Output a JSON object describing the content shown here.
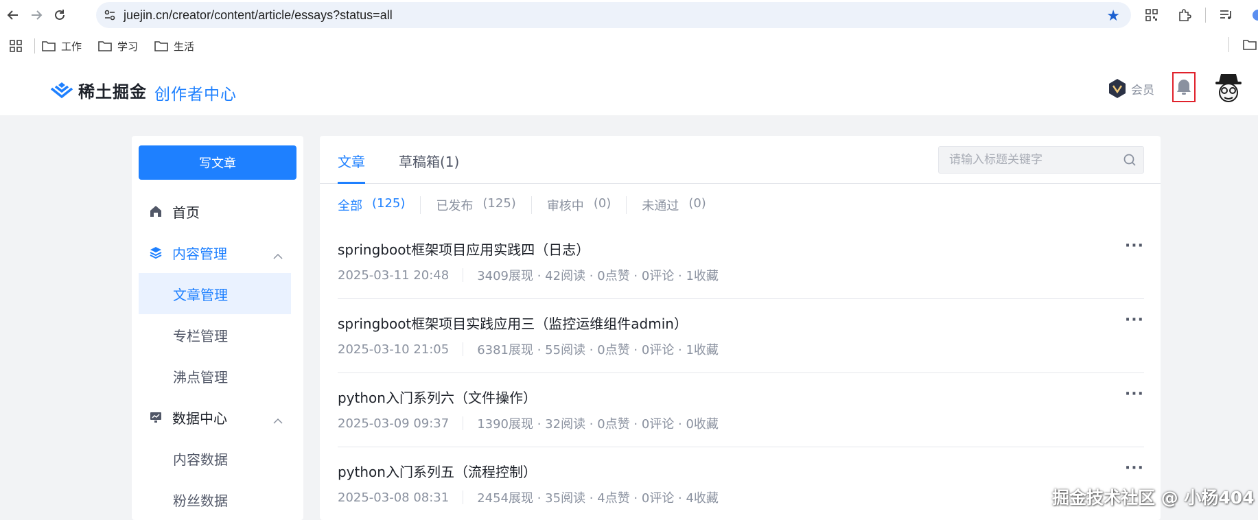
{
  "browser": {
    "url": "juejin.cn/creator/content/article/essays?status=all",
    "bookmarks": [
      "工作",
      "学习",
      "生活"
    ]
  },
  "header": {
    "logo_text": "稀土掘金",
    "creator_center": "创作者中心",
    "vip_label": "会员"
  },
  "sidebar": {
    "write_button": "写文章",
    "home": "首页",
    "content_manage": "内容管理",
    "content_items": [
      "文章管理",
      "专栏管理",
      "沸点管理"
    ],
    "data_center": "数据中心",
    "data_items": [
      "内容数据",
      "粉丝数据"
    ]
  },
  "tabs": {
    "articles": "文章",
    "drafts": "草稿箱(1)"
  },
  "search": {
    "placeholder": "请输入标题关键字"
  },
  "filters": [
    {
      "label": "全部",
      "count": "(125)"
    },
    {
      "label": "已发布",
      "count": "(125)"
    },
    {
      "label": "审核中",
      "count": "(0)"
    },
    {
      "label": "未通过",
      "count": "(0)"
    }
  ],
  "articles": [
    {
      "title": "springboot框架项目应用实践四（日志）",
      "date": "2025-03-11 20:48",
      "stats": "3409展现 · 42阅读 · 0点赞 · 0评论 · 1收藏"
    },
    {
      "title": "springboot框架项目实践应用三（监控运维组件admin）",
      "date": "2025-03-10 21:05",
      "stats": "6381展现 · 55阅读 · 0点赞 · 0评论 · 1收藏"
    },
    {
      "title": "python入门系列六（文件操作）",
      "date": "2025-03-09 09:37",
      "stats": "1390展现 · 32阅读 · 0点赞 · 0评论 · 0收藏"
    },
    {
      "title": "python入门系列五（流程控制）",
      "date": "2025-03-08 08:31",
      "stats": "2454展现 · 35阅读 · 4点赞 · 0评论 · 4收藏"
    }
  ],
  "more_label": "···",
  "watermark": "掘金技术社区 @ 小杨404",
  "colors": {
    "accent": "#1e80ff",
    "highlight_border": "#e0212b"
  }
}
